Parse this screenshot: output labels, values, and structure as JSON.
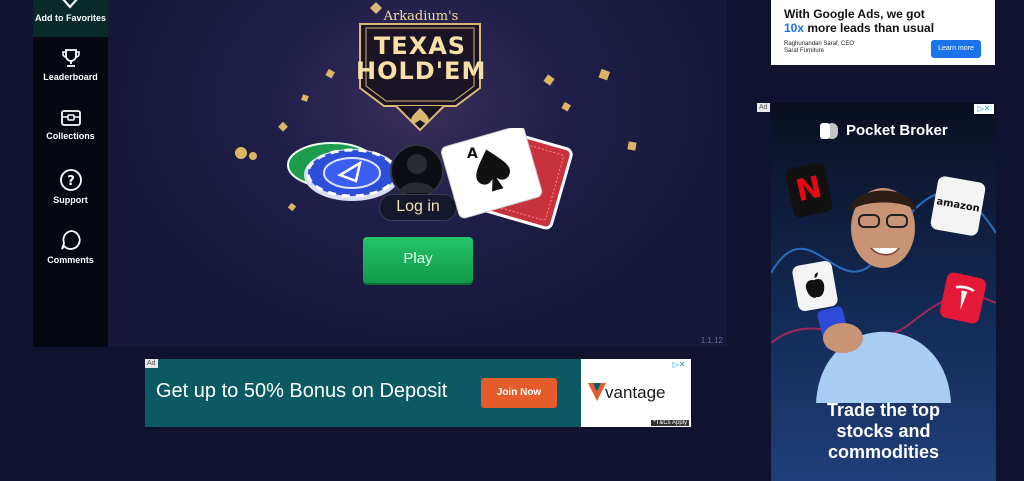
{
  "sidebar": {
    "items": [
      {
        "label": "Add to Favorites",
        "icon": "heart-icon"
      },
      {
        "label": "Leaderboard",
        "icon": "trophy-icon"
      },
      {
        "label": "Collections",
        "icon": "collections-icon"
      },
      {
        "label": "Support",
        "icon": "help-icon"
      },
      {
        "label": "Comments",
        "icon": "comment-icon"
      }
    ]
  },
  "game": {
    "publisher": "Arkadium's",
    "title_line1": "TEXAS",
    "title_line2": "HOLD'EM",
    "login_label": "Log in",
    "play_label": "Play",
    "version": "1.1.12",
    "card_rank": "A"
  },
  "ads": {
    "tag": "Ad",
    "bottom": {
      "headline": "Get up to 50% Bonus on Deposit",
      "button": "Join Now",
      "brand": "vantage",
      "terms": "*T&Cs Apply"
    },
    "top_right": {
      "line1": "With Google Ads, we got",
      "highlight": "10x",
      "line2_rest": " more leads than usual",
      "person": "Raghunandan Saraf, CEO",
      "company": "Saraf Furniture",
      "button": "Learn more"
    },
    "side": {
      "brand": "Pocket Broker",
      "tagline1": "Trade the top",
      "tagline2": "stocks and",
      "tagline3": "commodities",
      "tiles": {
        "netflix": "N",
        "amazon": "amazon"
      }
    }
  },
  "colors": {
    "background": "#0f1330",
    "play_green": "#1fb35e",
    "join_orange": "#e45c2a",
    "learn_blue": "#1a73e8"
  }
}
